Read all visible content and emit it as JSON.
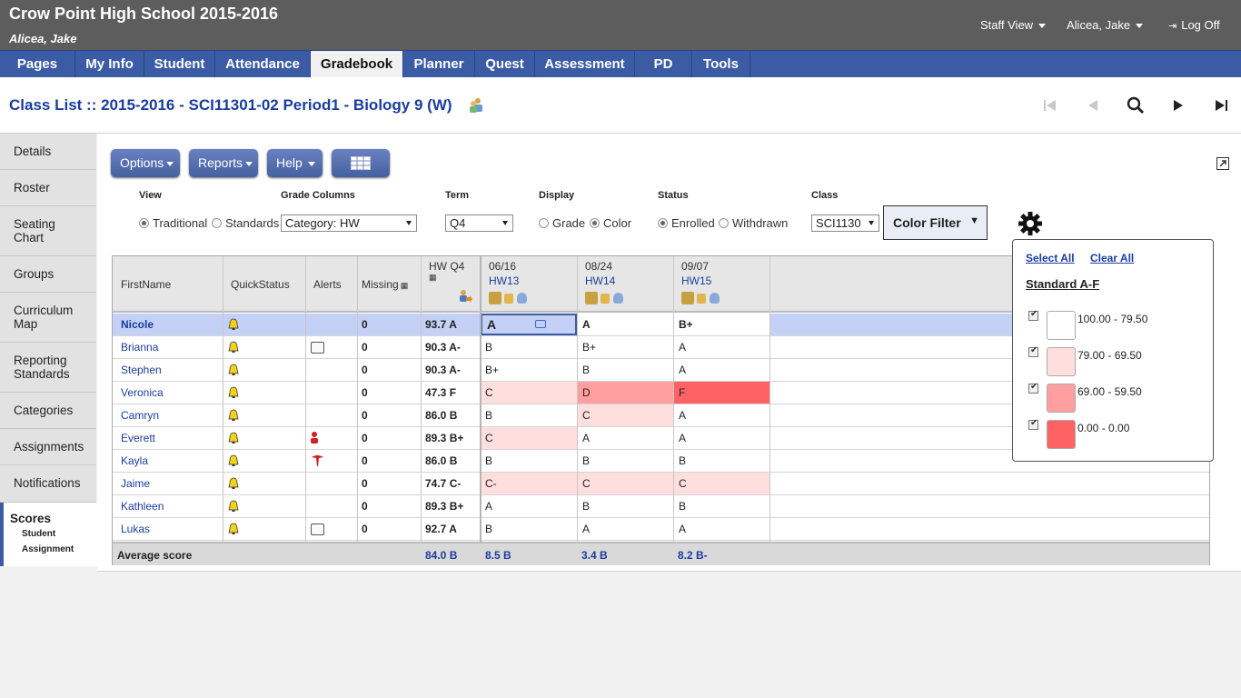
{
  "header": {
    "school": "Crow Point High School 2015-2016",
    "user": "Alicea, Jake",
    "staff_view": "Staff View",
    "user_menu": "Alicea, Jake",
    "logoff": "Log Off"
  },
  "nav": {
    "tabs": [
      "Pages",
      "My Info",
      "Student",
      "Attendance",
      "Gradebook",
      "Planner",
      "Quest",
      "Assessment",
      "PD",
      "Tools"
    ],
    "active": "Gradebook"
  },
  "title": {
    "prefix": "Class List :: ",
    "text": "2015-2016 - SCI11301-02 Period1 - Biology 9 (W)"
  },
  "sidebar": {
    "items": [
      "Details",
      "Roster",
      "Seating Chart",
      "Groups",
      "Curriculum Map",
      "Reporting Standards",
      "Categories",
      "Assignments",
      "Notifications"
    ],
    "active": "Scores",
    "active_sub": [
      "Student",
      "Assignment"
    ]
  },
  "toolbar": {
    "options": "Options",
    "reports": "Reports",
    "help": "Help"
  },
  "filters": {
    "view_label": "View",
    "view_traditional": "Traditional",
    "view_standards": "Standards",
    "grade_columns_label": "Grade Columns",
    "grade_columns_value": "Category: HW",
    "term_label": "Term",
    "term_value": "Q4",
    "display_label": "Display",
    "display_grade": "Grade",
    "display_color": "Color",
    "status_label": "Status",
    "status_enrolled": "Enrolled",
    "status_withdrawn": "Withdrawn",
    "class_label": "Class",
    "class_value": "SCI1130",
    "color_filter": "Color Filter"
  },
  "table": {
    "headers": {
      "firstname": "FirstName",
      "quickstatus": "QuickStatus",
      "alerts": "Alerts",
      "missing": "Missing",
      "hw": "HW Q4",
      "a1_date": "06/16",
      "a1_name": "HW13",
      "a2_date": "08/24",
      "a2_name": "HW14",
      "a3_date": "09/07",
      "a3_name": "HW15"
    },
    "rows": [
      {
        "name": "Nicole",
        "missing": "0",
        "avg": "93.7 A",
        "g1": "A",
        "g2": "A",
        "g3": "B+",
        "alert": ""
      },
      {
        "name": "Brianna",
        "missing": "0",
        "avg": "90.3 A-",
        "g1": "B",
        "g2": "B+",
        "g3": "A",
        "alert": "iep"
      },
      {
        "name": "Stephen",
        "missing": "0",
        "avg": "90.3 A-",
        "g1": "B+",
        "g2": "B",
        "g3": "A",
        "alert": ""
      },
      {
        "name": "Veronica",
        "missing": "0",
        "avg": "47.3 F",
        "g1": "C",
        "g2": "D",
        "g3": "F",
        "alert": ""
      },
      {
        "name": "Camryn",
        "missing": "0",
        "avg": "86.0 B",
        "g1": "B",
        "g2": "C",
        "g3": "A",
        "alert": ""
      },
      {
        "name": "Everett",
        "missing": "0",
        "avg": "89.3 B+",
        "g1": "C",
        "g2": "A",
        "g3": "A",
        "alert": "person"
      },
      {
        "name": "Kayla",
        "missing": "0",
        "avg": "86.0 B",
        "g1": "B",
        "g2": "B",
        "g3": "B",
        "alert": "medical"
      },
      {
        "name": "Jaime",
        "missing": "0",
        "avg": "74.7 C-",
        "g1": "C-",
        "g2": "C",
        "g3": "C",
        "alert": ""
      },
      {
        "name": "Kathleen",
        "missing": "0",
        "avg": "89.3 B+",
        "g1": "A",
        "g2": "B",
        "g3": "B",
        "alert": ""
      },
      {
        "name": "Lukas",
        "missing": "0",
        "avg": "92.7 A",
        "g1": "B",
        "g2": "A",
        "g3": "A",
        "alert": "iep"
      }
    ],
    "footer": {
      "label": "Average score",
      "hw": "84.0 B",
      "a1": "8.5 B",
      "a2": "3.4 B",
      "a3": "8.2 B-"
    }
  },
  "color_popup": {
    "select_all": "Select All",
    "clear_all": "Clear All",
    "standard": "Standard A-F",
    "ranges": [
      {
        "label": "100.00 - 79.50",
        "color": "#ffffff"
      },
      {
        "label": "79.00 - 69.50",
        "color": "#ffdede"
      },
      {
        "label": "69.00 - 59.50",
        "color": "#ff9f9f"
      },
      {
        "label": "0.00 - 0.00",
        "color": "#ff6262"
      }
    ]
  }
}
